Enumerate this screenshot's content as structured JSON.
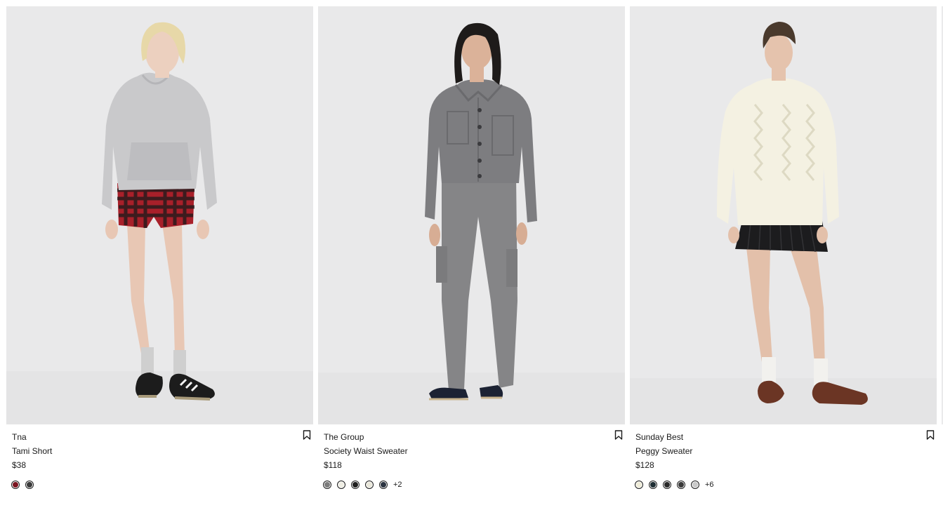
{
  "products": [
    {
      "brand": "Tna",
      "name": "Tami Short",
      "price": "$38",
      "swatches": [
        "#7a1420",
        "#3a3a3a"
      ],
      "more": ""
    },
    {
      "brand": "The Group",
      "name": "Society Waist Sweater",
      "price": "$118",
      "swatches": [
        "#7c7c7c",
        "#efeee4",
        "#1e1e1e",
        "#e9e7da",
        "#2b3340"
      ],
      "more": "+2"
    },
    {
      "brand": "Sunday Best",
      "name": "Peggy Sweater",
      "price": "$128",
      "swatches": [
        "#efecd8",
        "#1d2d33",
        "#2a2a2a",
        "#3a3a3a",
        "#c9c9c9"
      ],
      "more": "+6"
    }
  ],
  "icons": {
    "wishlist": "bookmark-icon"
  }
}
